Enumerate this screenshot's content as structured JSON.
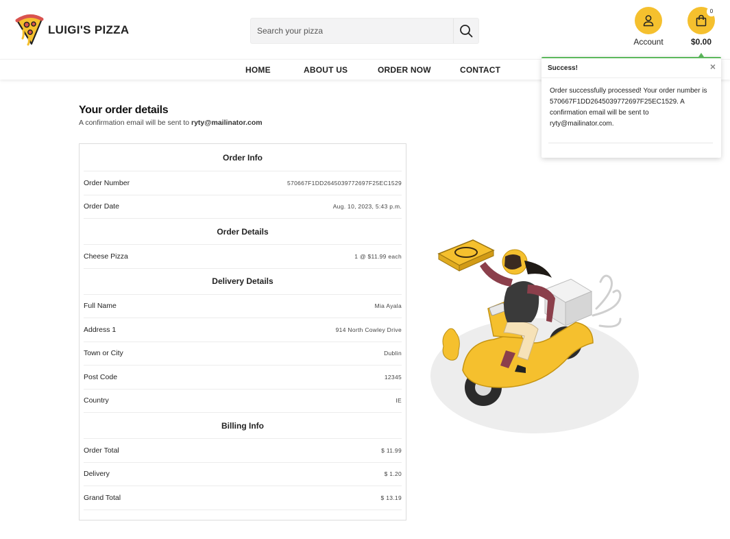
{
  "brand": {
    "name": "LUIGI'S PIZZA",
    "accent": "#f5c02e"
  },
  "search": {
    "placeholder": "Search your pizza"
  },
  "account": {
    "label": "Account"
  },
  "cart": {
    "count": "0",
    "total": "$0.00"
  },
  "nav": {
    "items": [
      "HOME",
      "ABOUT US",
      "ORDER NOW",
      "CONTACT"
    ]
  },
  "page": {
    "title": "Your order details",
    "subtitle_prefix": "A confirmation email will be sent to ",
    "email": "ryty@mailinator.com"
  },
  "order_info": {
    "heading": "Order Info",
    "rows": [
      {
        "label": "Order Number",
        "value": "570667F1DD2645039772697F25EC1529"
      },
      {
        "label": "Order Date",
        "value": "Aug. 10, 2023, 5:43 p.m."
      }
    ]
  },
  "order_details": {
    "heading": "Order Details",
    "rows": [
      {
        "label": "Cheese Pizza",
        "value": "1 @ $11.99 each"
      }
    ]
  },
  "delivery_details": {
    "heading": "Delivery Details",
    "rows": [
      {
        "label": "Full Name",
        "value": "Mia Ayala"
      },
      {
        "label": "Address 1",
        "value": "914 North Cowley Drive"
      },
      {
        "label": "Town or City",
        "value": "Dublin"
      },
      {
        "label": "Post Code",
        "value": "12345"
      },
      {
        "label": "Country",
        "value": "IE"
      }
    ]
  },
  "billing_info": {
    "heading": "Billing Info",
    "rows": [
      {
        "label": "Order Total",
        "value": "$ 11.99"
      },
      {
        "label": "Delivery",
        "value": "$ 1.20"
      },
      {
        "label": "Grand Total",
        "value": "$ 13.19"
      }
    ]
  },
  "toast": {
    "title": "Success!",
    "close": "×",
    "message": "Order successfully processed! Your order number is 570667F1DD2645039772697F25EC1529. A confirmation email will be sent to ryty@mailinator.com.",
    "color": "#5cb85c"
  },
  "icons": {
    "logo": "pizza-slice-icon",
    "search": "search-icon",
    "account": "user-icon",
    "cart": "shopping-bag-icon",
    "close": "close-icon"
  }
}
